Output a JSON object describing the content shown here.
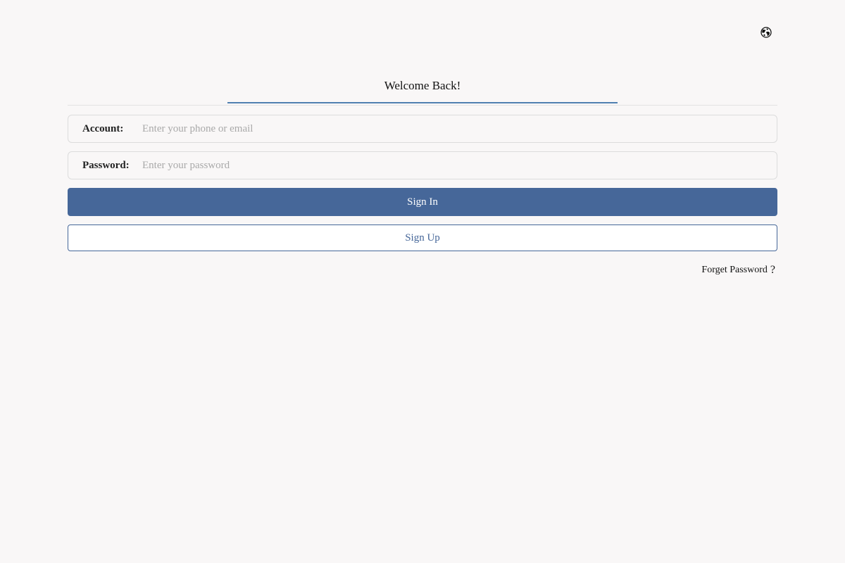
{
  "header": {
    "language_icon": "globe-icon"
  },
  "tabs": {
    "active_label": "Welcome Back!"
  },
  "form": {
    "account_label": "Account:",
    "account_placeholder": "Enter your phone or email",
    "account_value": "",
    "password_label": "Password:",
    "password_placeholder": "Enter your password",
    "password_value": "",
    "signin_label": "Sign In",
    "signup_label": "Sign Up",
    "forget_label": "Forget Password",
    "forget_suffix": "?"
  },
  "colors": {
    "primary": "#466799",
    "tab_underline": "#4f7fb0",
    "background": "#f9f7f7"
  }
}
